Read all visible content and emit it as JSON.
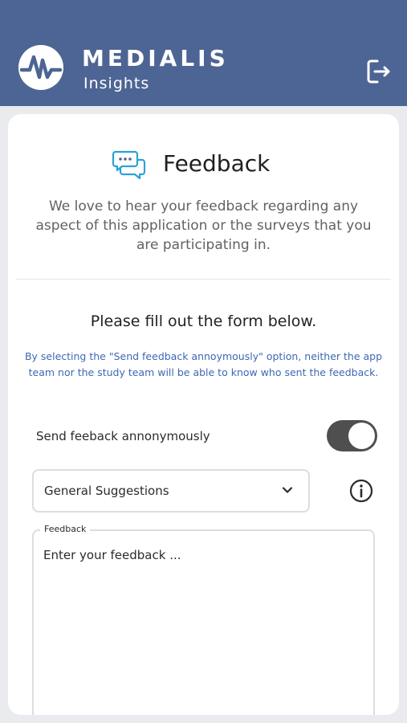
{
  "header": {
    "brand_name": "MEDIALIS",
    "brand_sub": "Insights",
    "logout_icon": "logout-icon",
    "background_color": "#4d6594"
  },
  "intro": {
    "icon": "chat-bubbles-icon",
    "title": "Feedback",
    "description": "We love to hear your feedback regarding any aspect of this application or the surveys that you are participating in."
  },
  "form": {
    "heading": "Please fill out the form below.",
    "anonymous_note": "By selecting the \"Send feedback annoymously\" option, neither the app team nor the study team will be able to know who sent the feedback.",
    "anonymous_label": "Send feeback annonymously",
    "anonymous_enabled": true,
    "category_selected": "General Suggestions",
    "info_icon": "info-icon",
    "feedback_label": "Feedback",
    "feedback_placeholder": "Enter your feedback ...",
    "feedback_value": ""
  },
  "colors": {
    "accent_note": "#3f68b5",
    "toggle_on": "#4f4f4f",
    "icon_blue": "#29a3d6"
  }
}
